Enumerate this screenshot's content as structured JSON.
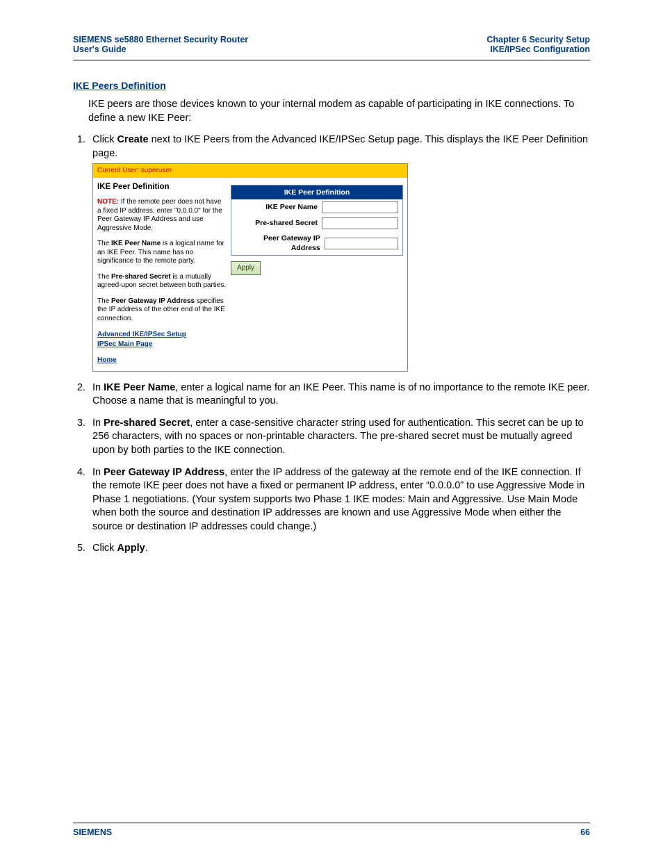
{
  "header": {
    "left_line1": "SIEMENS se5880 Ethernet Security Router",
    "left_line2": "User's Guide",
    "right_line1": "Chapter 6  Security Setup",
    "right_line2": "IKE/IPSec Configuration"
  },
  "section_title": "IKE Peers Definition",
  "intro": "IKE peers are those devices known to your internal modem as capable of participating in IKE connections. To define a new IKE Peer:",
  "steps": {
    "s1_pre": "Click ",
    "s1_bold": "Create",
    "s1_post": " next to IKE Peers from the Advanced IKE/IPSec Setup page. This displays the IKE Peer Definition page.",
    "s2_pre": "In ",
    "s2_bold": "IKE Peer Name",
    "s2_post": ", enter a logical name for an IKE Peer. This name is of no importance to the remote IKE peer. Choose a name that is meaningful to you.",
    "s3_pre": "In ",
    "s3_bold": "Pre-shared Secret",
    "s3_post": ", enter a case-sensitive character string used for authentication. This secret can be up to 256 characters, with no spaces or non-printable characters. The pre-shared secret must be mutually agreed upon by both parties to the IKE connection.",
    "s4_pre": "In ",
    "s4_bold": "Peer Gateway IP Address",
    "s4_post": ", enter the IP address of the gateway at the remote end of the IKE connection. If the remote IKE peer does not have a fixed or permanent IP address, enter “0.0.0.0” to use Aggressive Mode in Phase 1 negotiations. (Your system supports two Phase 1 IKE modes: Main and Aggressive. Use Main Mode when both the source and destination IP addresses are known and use Aggressive Mode when either the source or destination IP addresses could change.)",
    "s5_pre": "Click ",
    "s5_bold": "Apply",
    "s5_post": "."
  },
  "embed": {
    "userbar": "Current User: superuser",
    "title": "IKE Peer Definition",
    "note_label": "NOTE:",
    "note_text": " If the remote peer does not have a fixed IP address, enter \"0.0.0.0\" for the Peer Gateway IP Address and use Aggressive Mode.",
    "p1_pre": "The ",
    "p1_b": "IKE Peer Name",
    "p1_post": " is a logical name for an IKE Peer. This name has no significance to the remote party.",
    "p2_pre": "The ",
    "p2_b": "Pre-shared Secret",
    "p2_post": " is a mutually agreed-upon secret between both parties.",
    "p3_pre": "The ",
    "p3_b": "Peer Gateway IP Address",
    "p3_post": " specifies the IP address of the other end of the IKE connection.",
    "link1": "Advanced IKE/IPSec Setup",
    "link2": "IPSec Main Page",
    "link3": "Home",
    "form_header": "IKE Peer Definition",
    "field1": "IKE Peer Name",
    "field2": "Pre-shared Secret",
    "field3": "Peer Gateway IP Address",
    "apply": "Apply"
  },
  "footer": {
    "brand": "SIEMENS",
    "page": "66"
  }
}
